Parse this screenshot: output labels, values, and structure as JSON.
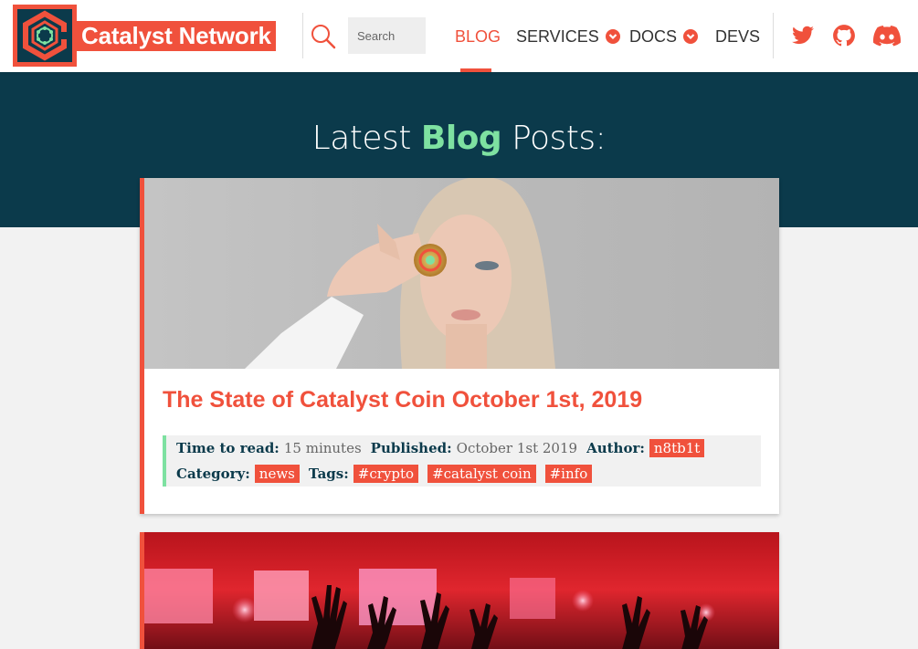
{
  "brand": {
    "name": "Catalyst Network"
  },
  "search": {
    "placeholder": "Search"
  },
  "nav": {
    "items": [
      {
        "label": "BLOG",
        "active": true,
        "dropdown": false
      },
      {
        "label": "SERVICES",
        "active": false,
        "dropdown": true
      },
      {
        "label": "DOCS",
        "active": false,
        "dropdown": true
      },
      {
        "label": "DEVS",
        "active": false,
        "dropdown": false
      }
    ],
    "social": [
      "twitter-icon",
      "github-icon",
      "discord-icon"
    ]
  },
  "hero": {
    "title_pre": "Latest ",
    "title_highlight": "Blog",
    "title_post": " Posts:"
  },
  "posts": [
    {
      "title": "The State of Catalyst Coin October 1st, 2019",
      "time_label": "Time to read:",
      "time_value": "15 minutes",
      "published_label": "Published:",
      "published_value": "October 1st 2019",
      "author_label": "Author:",
      "author": "n8tb1t",
      "category_label": "Category:",
      "category": "news",
      "tags_label": "Tags:",
      "tags": [
        "#crypto",
        "#catalyst coin",
        "#info"
      ]
    }
  ],
  "colors": {
    "accent": "#f0513c",
    "dark": "#0b3a4b",
    "green": "#7ee1a1",
    "background": "#f2f2f2"
  }
}
